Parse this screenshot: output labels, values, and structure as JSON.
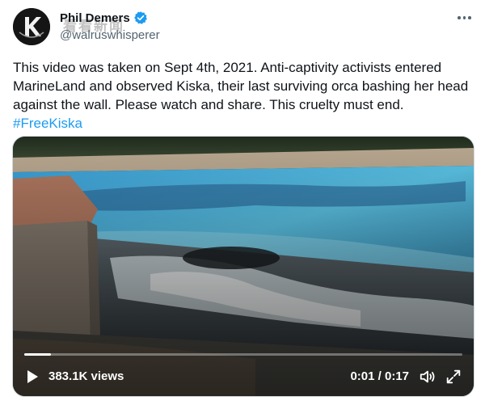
{
  "author": {
    "display_name": "Phil Demers",
    "handle": "@walruswhisperer",
    "verified": true,
    "avatar_icon": "avatar-k-logo"
  },
  "watermark": "看看新闻",
  "tweet": {
    "text": "This video was taken on Sept 4th, 2021. Anti-captivity activists entered MarineLand and observed Kiska, their last surviving orca bashing her head against the wall. Please watch and share. This cruelty must end.",
    "hashtag": "#FreeKiska"
  },
  "video": {
    "views_label": "383.1K views",
    "time_label": "0:01 / 0:17",
    "progress": 0.06
  },
  "colors": {
    "accent": "#1d9bf0",
    "text": "#0f1419",
    "secondary": "#536471"
  },
  "icons": [
    "verified-badge-icon",
    "more-icon",
    "play-icon",
    "volume-icon",
    "fullscreen-icon"
  ]
}
